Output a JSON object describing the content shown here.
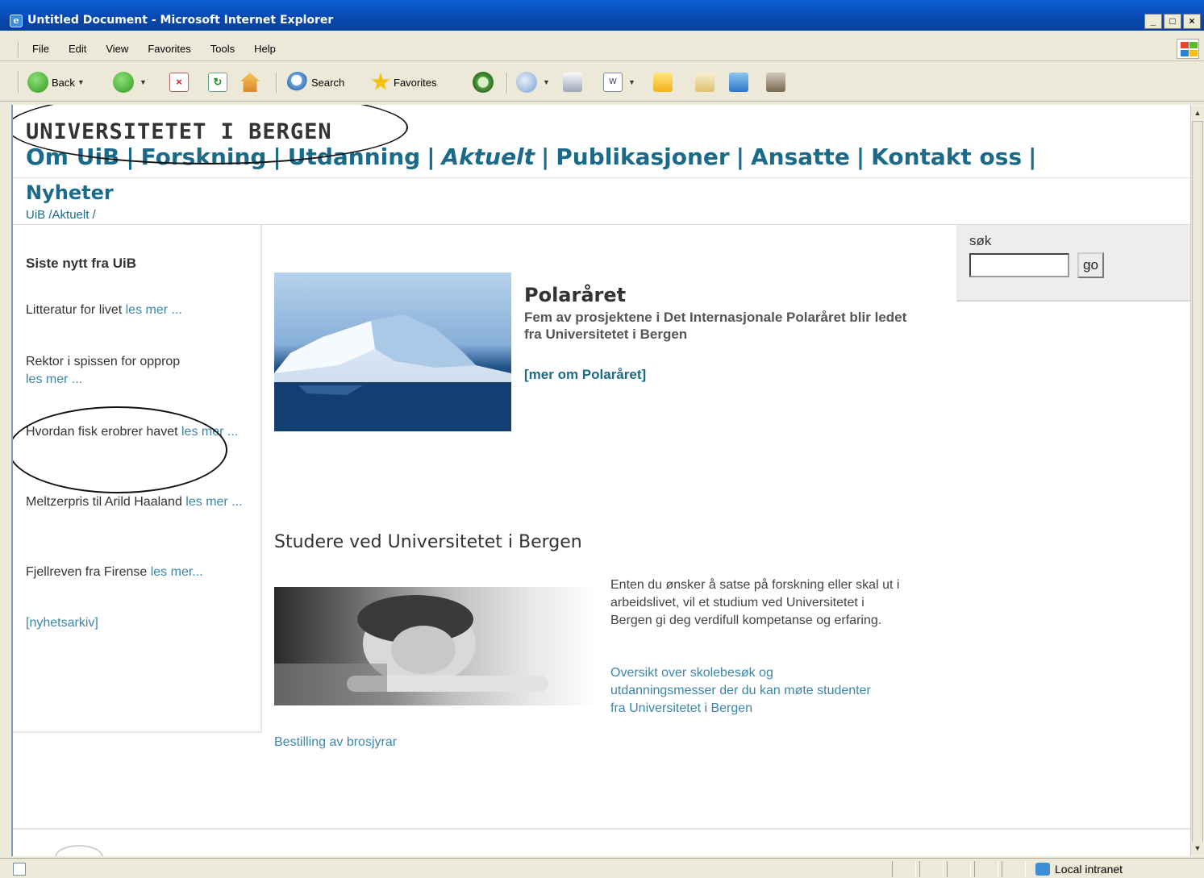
{
  "window": {
    "title": "Untitled Document - Microsoft Internet Explorer",
    "buttons": [
      "_",
      "□",
      "×"
    ]
  },
  "menubar": {
    "items": [
      "File",
      "Edit",
      "View",
      "Favorites",
      "Tools",
      "Help"
    ]
  },
  "toolbar": {
    "back_label": "Back",
    "search_label": "Search",
    "favorites_label": "Favorites"
  },
  "page": {
    "site_title": "UNIVERSITETET I BERGEN",
    "nav": [
      "Om UiB",
      "Forskning",
      "Utdanning",
      "Aktuelt",
      "Publikasjoner",
      "Ansatte",
      "Kontakt oss"
    ],
    "nav_sep": "|",
    "section_title": "Nyheter",
    "breadcrumb": [
      "UiB",
      "Aktuelt"
    ],
    "breadcrumb_sep": "/"
  },
  "news": {
    "heading": "Siste nytt fra UiB",
    "items": [
      {
        "text": "Litteratur for livet ",
        "link": "les mer ..."
      },
      {
        "text": "Rektor i spissen for opprop ",
        "link": "les mer ..."
      },
      {
        "text": "Hvordan fisk erobrer havet ",
        "link": "les mer ..."
      },
      {
        "text": "Meltzerpris til Arild Haaland ",
        "link": "les mer ..."
      },
      {
        "text": "Fjellreven fra Firense ",
        "link": "les mer..."
      }
    ],
    "archive": "[nyhetsarkiv]"
  },
  "search": {
    "label": "søk",
    "value": "",
    "button": "go"
  },
  "feature": {
    "title": "Polaråret",
    "description": "Fem av prosjektene i Det Internasjonale Polaråret blir ledet fra Universitetet i Bergen",
    "link": "[mer om Polaråret]"
  },
  "study": {
    "title": "Studere ved Universitetet i Bergen",
    "text": "Enten du ønsker å satse på forskning eller skal ut i arbeidslivet, vil et studium ved Universitetet i Bergen gi deg verdifull kompetanse og erfaring.",
    "link": "Oversikt over skolebesøk og utdanningsmesser der du kan møte studenter fra Universitetet i Bergen",
    "brochure": "Bestilling av brosjyrar"
  },
  "statusbar": {
    "zone": "Local intranet"
  },
  "colors": {
    "link": "#3a86ad",
    "nav": "#1a6a8a",
    "titlebar": "#0848b0"
  }
}
